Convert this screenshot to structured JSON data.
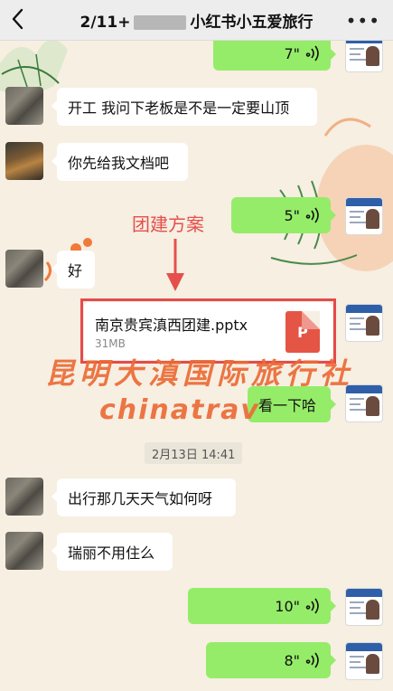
{
  "header": {
    "title_prefix": "2/11+",
    "title_suffix": "小红书小五爱旅行",
    "more": "•••"
  },
  "annotation": {
    "label": "团建方案",
    "color": "#e5504c"
  },
  "watermark": {
    "line1": "昆明大滇国际旅行社",
    "line2": "chinatrav"
  },
  "timestamp": "2月13日 14:41",
  "messages": {
    "m1_voice": "7\"",
    "m2": "开工 我问下老板是不是一定要山顶",
    "m3": "你先给我文档吧",
    "m4_voice": "5\"",
    "m5": "好",
    "m6_file": {
      "name": "南京贵宾滇西团建.pptx",
      "size": "31MB",
      "type_icon": "P"
    },
    "m7": "看一下哈",
    "m8": "出行那几天天气如何呀",
    "m9": "瑞丽不用住么",
    "m10_voice": "10\"",
    "m11_voice": "8\""
  },
  "colors": {
    "bubble_green": "#95ec69",
    "bubble_white": "#ffffff",
    "highlight_red": "#e54b4b",
    "watermark": "#ec6b36"
  }
}
